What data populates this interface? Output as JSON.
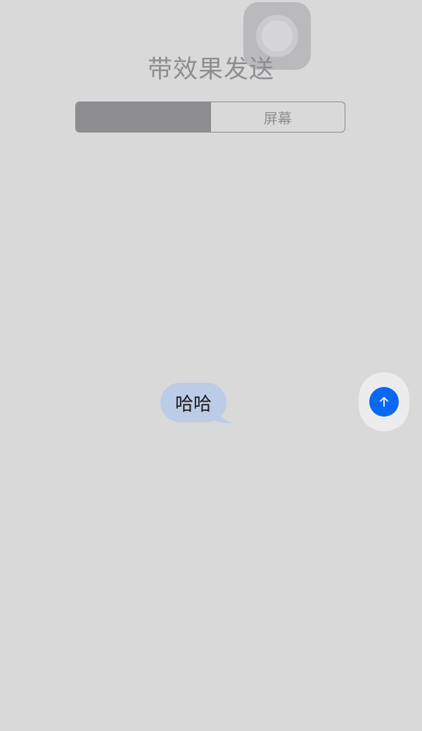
{
  "header": {
    "title": "带效果发送"
  },
  "segmented_control": {
    "segments": [
      {
        "label": "",
        "selected": true
      },
      {
        "label": "屏幕",
        "selected": false
      }
    ]
  },
  "message": {
    "text": "哈哈"
  },
  "icons": {
    "assistive_touch": "assistive-touch-icon",
    "send": "arrow-up-icon"
  },
  "colors": {
    "bubble": "#bccbe6",
    "send_button": "#0a68f5",
    "background": "#d9d9da"
  }
}
